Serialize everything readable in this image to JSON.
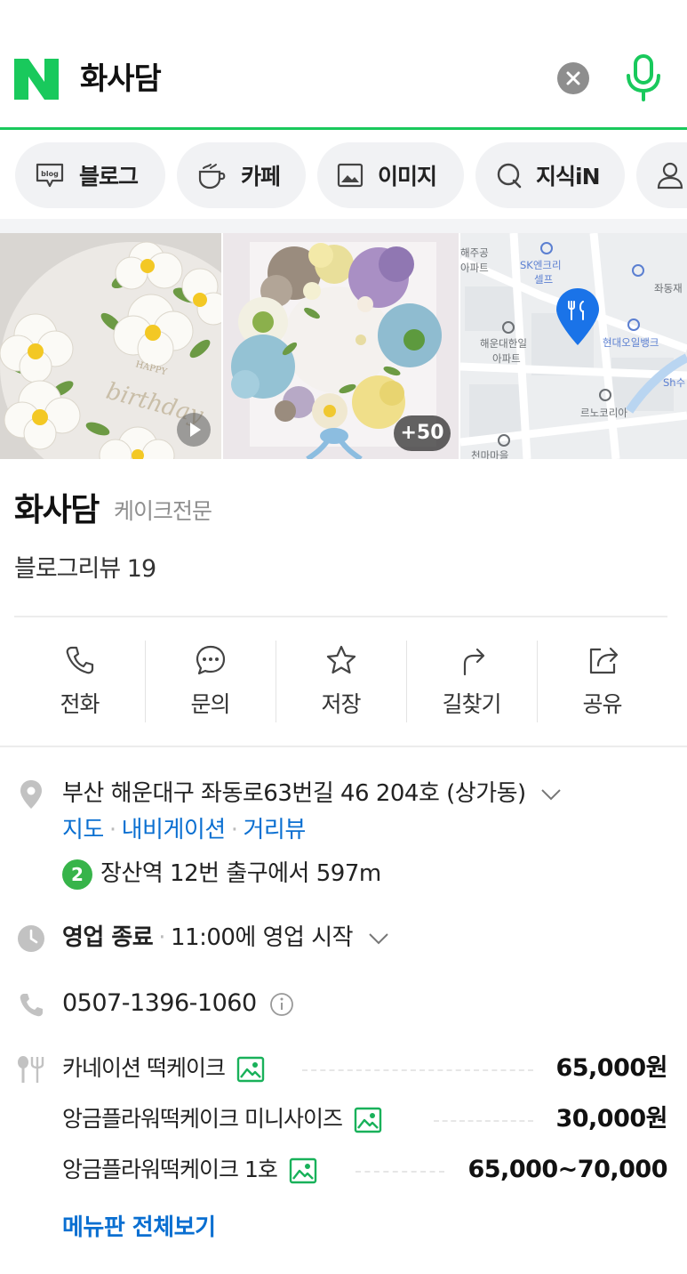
{
  "search": {
    "query": "화사담"
  },
  "tabs": [
    {
      "label": "블로그",
      "icon": "blog-icon"
    },
    {
      "label": "카페",
      "icon": "cafe-cup-icon"
    },
    {
      "label": "이미지",
      "icon": "image-icon"
    },
    {
      "label": "지식iN",
      "icon": "knowledge-q-icon"
    },
    {
      "label": "",
      "icon": "person-icon"
    }
  ],
  "photos": {
    "more_count": "+50"
  },
  "place": {
    "name": "화사담",
    "category": "케이크전문",
    "review": "블로그리뷰 19"
  },
  "actions": [
    {
      "label": "전화",
      "icon": "phone-icon"
    },
    {
      "label": "문의",
      "icon": "chat-icon"
    },
    {
      "label": "저장",
      "icon": "star-icon"
    },
    {
      "label": "길찾기",
      "icon": "directions-icon"
    },
    {
      "label": "공유",
      "icon": "share-icon"
    }
  ],
  "info": {
    "address": "부산 해운대구 좌동로63번길 46 204호 (상가동)",
    "links": [
      "지도",
      "내비게이션",
      "거리뷰"
    ],
    "subway_line": "2",
    "subway_text": "장산역 12번 출구에서 597m",
    "status": "영업 종료",
    "hours": "11:00에 영업 시작",
    "phone": "0507-1396-1060"
  },
  "map_labels": [
    "해주공 아파트",
    "SK엔크리 셀프",
    "좌동재",
    "현대오일뱅크",
    "해운대한일 아파트",
    "르노코리아",
    "Sh수",
    "천마마을"
  ],
  "menu": [
    {
      "name": "카네이션 떡케이크",
      "price": "65,000원"
    },
    {
      "name": "앙금플라워떡케이크 미니사이즈",
      "price": "30,000원"
    },
    {
      "name": "앙금플라워떡케이크 1호",
      "price": "65,000~70,000"
    }
  ],
  "more_menu_label": "메뉴판 전체보기",
  "colors": {
    "naver_green": "#19c95c",
    "link_blue": "#0a6fd1",
    "subway_line2": "#37b44a",
    "map_pin": "#1a73e8"
  }
}
